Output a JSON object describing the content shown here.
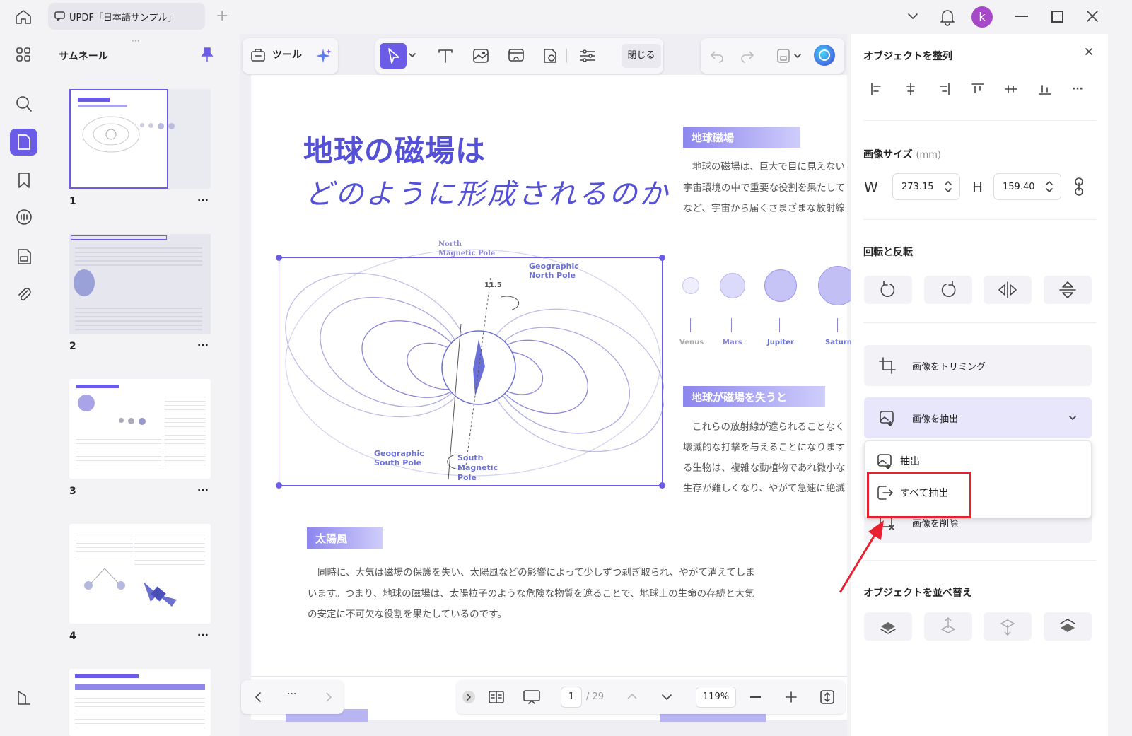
{
  "titlebar": {
    "tab_title": "UPDF「日本語サンプル」",
    "avatar": "k"
  },
  "thumbs": {
    "title": "サムネール",
    "pages": [
      "1",
      "2",
      "3",
      "4"
    ],
    "more": "···"
  },
  "toolbar": {
    "tool_label": "ツール",
    "close_label": "閉じる"
  },
  "doc": {
    "title_line1": "地球の磁場は",
    "title_line2": "どのように形成されるのか",
    "sec1": {
      "title": "地球磁場",
      "lines": [
        "地球の磁場は、巨大で目に見えない",
        "宇宙環境の中で重要な役割を果たして",
        "など、宇宙から届くさまざまな放射線"
      ]
    },
    "sec2": {
      "title": "地球が磁場を失うと",
      "lines": [
        "これらの放射線が遮られることなく",
        "壊滅的な打撃を与えることになります",
        "る生物は、複雑な動植物であれ微小な",
        "生存が難しくなり、やがて急速に絶滅"
      ]
    },
    "sec3": {
      "title": "太陽風",
      "lines": [
        "同時に、大気は磁場の保護を失い、太陽風などの影響によって少しずつ剥ぎ取られ、やがて消えてしま",
        "います。つまり、地球の磁場は、太陽粒子のような危険な物質を遮ることで、地球上の生命の存続と大気",
        "の安定に不可欠な役割を果たしているのです。"
      ]
    },
    "diagram": {
      "north_mag": "North",
      "north_mag2": "Magnetic Pole",
      "geo_north": "Geographic",
      "geo_north2": "North Pole",
      "angle": "11.5",
      "geo_south": "Geographic",
      "geo_south2": "South Pole",
      "south_mag": "South",
      "south_mag2": "Magnetic",
      "south_mag3": "Pole"
    },
    "planets": [
      "Venus",
      "Mars",
      "Jupiter",
      "Saturn"
    ]
  },
  "bottom": {
    "page": "1",
    "total": "/ 29",
    "zoom": "119%",
    "more": "···"
  },
  "panel": {
    "align_title": "オブジェクトを整列",
    "size_title": "画像サイズ",
    "size_unit": "(mm)",
    "w_label": "W",
    "w_value": "273.15",
    "h_label": "H",
    "h_value": "159.40",
    "rotate_title": "回転と反転",
    "crop_label": "画像をトリミング",
    "extract_label": "画像を抽出",
    "menu_extract": "抽出",
    "menu_extract_all": "すべて抽出",
    "delete_label": "画像を削除",
    "arrange_title": "オブジェクトを並べ替え"
  },
  "colors": {
    "accent": "#6b5ce7",
    "highlight": "#e8202f"
  }
}
